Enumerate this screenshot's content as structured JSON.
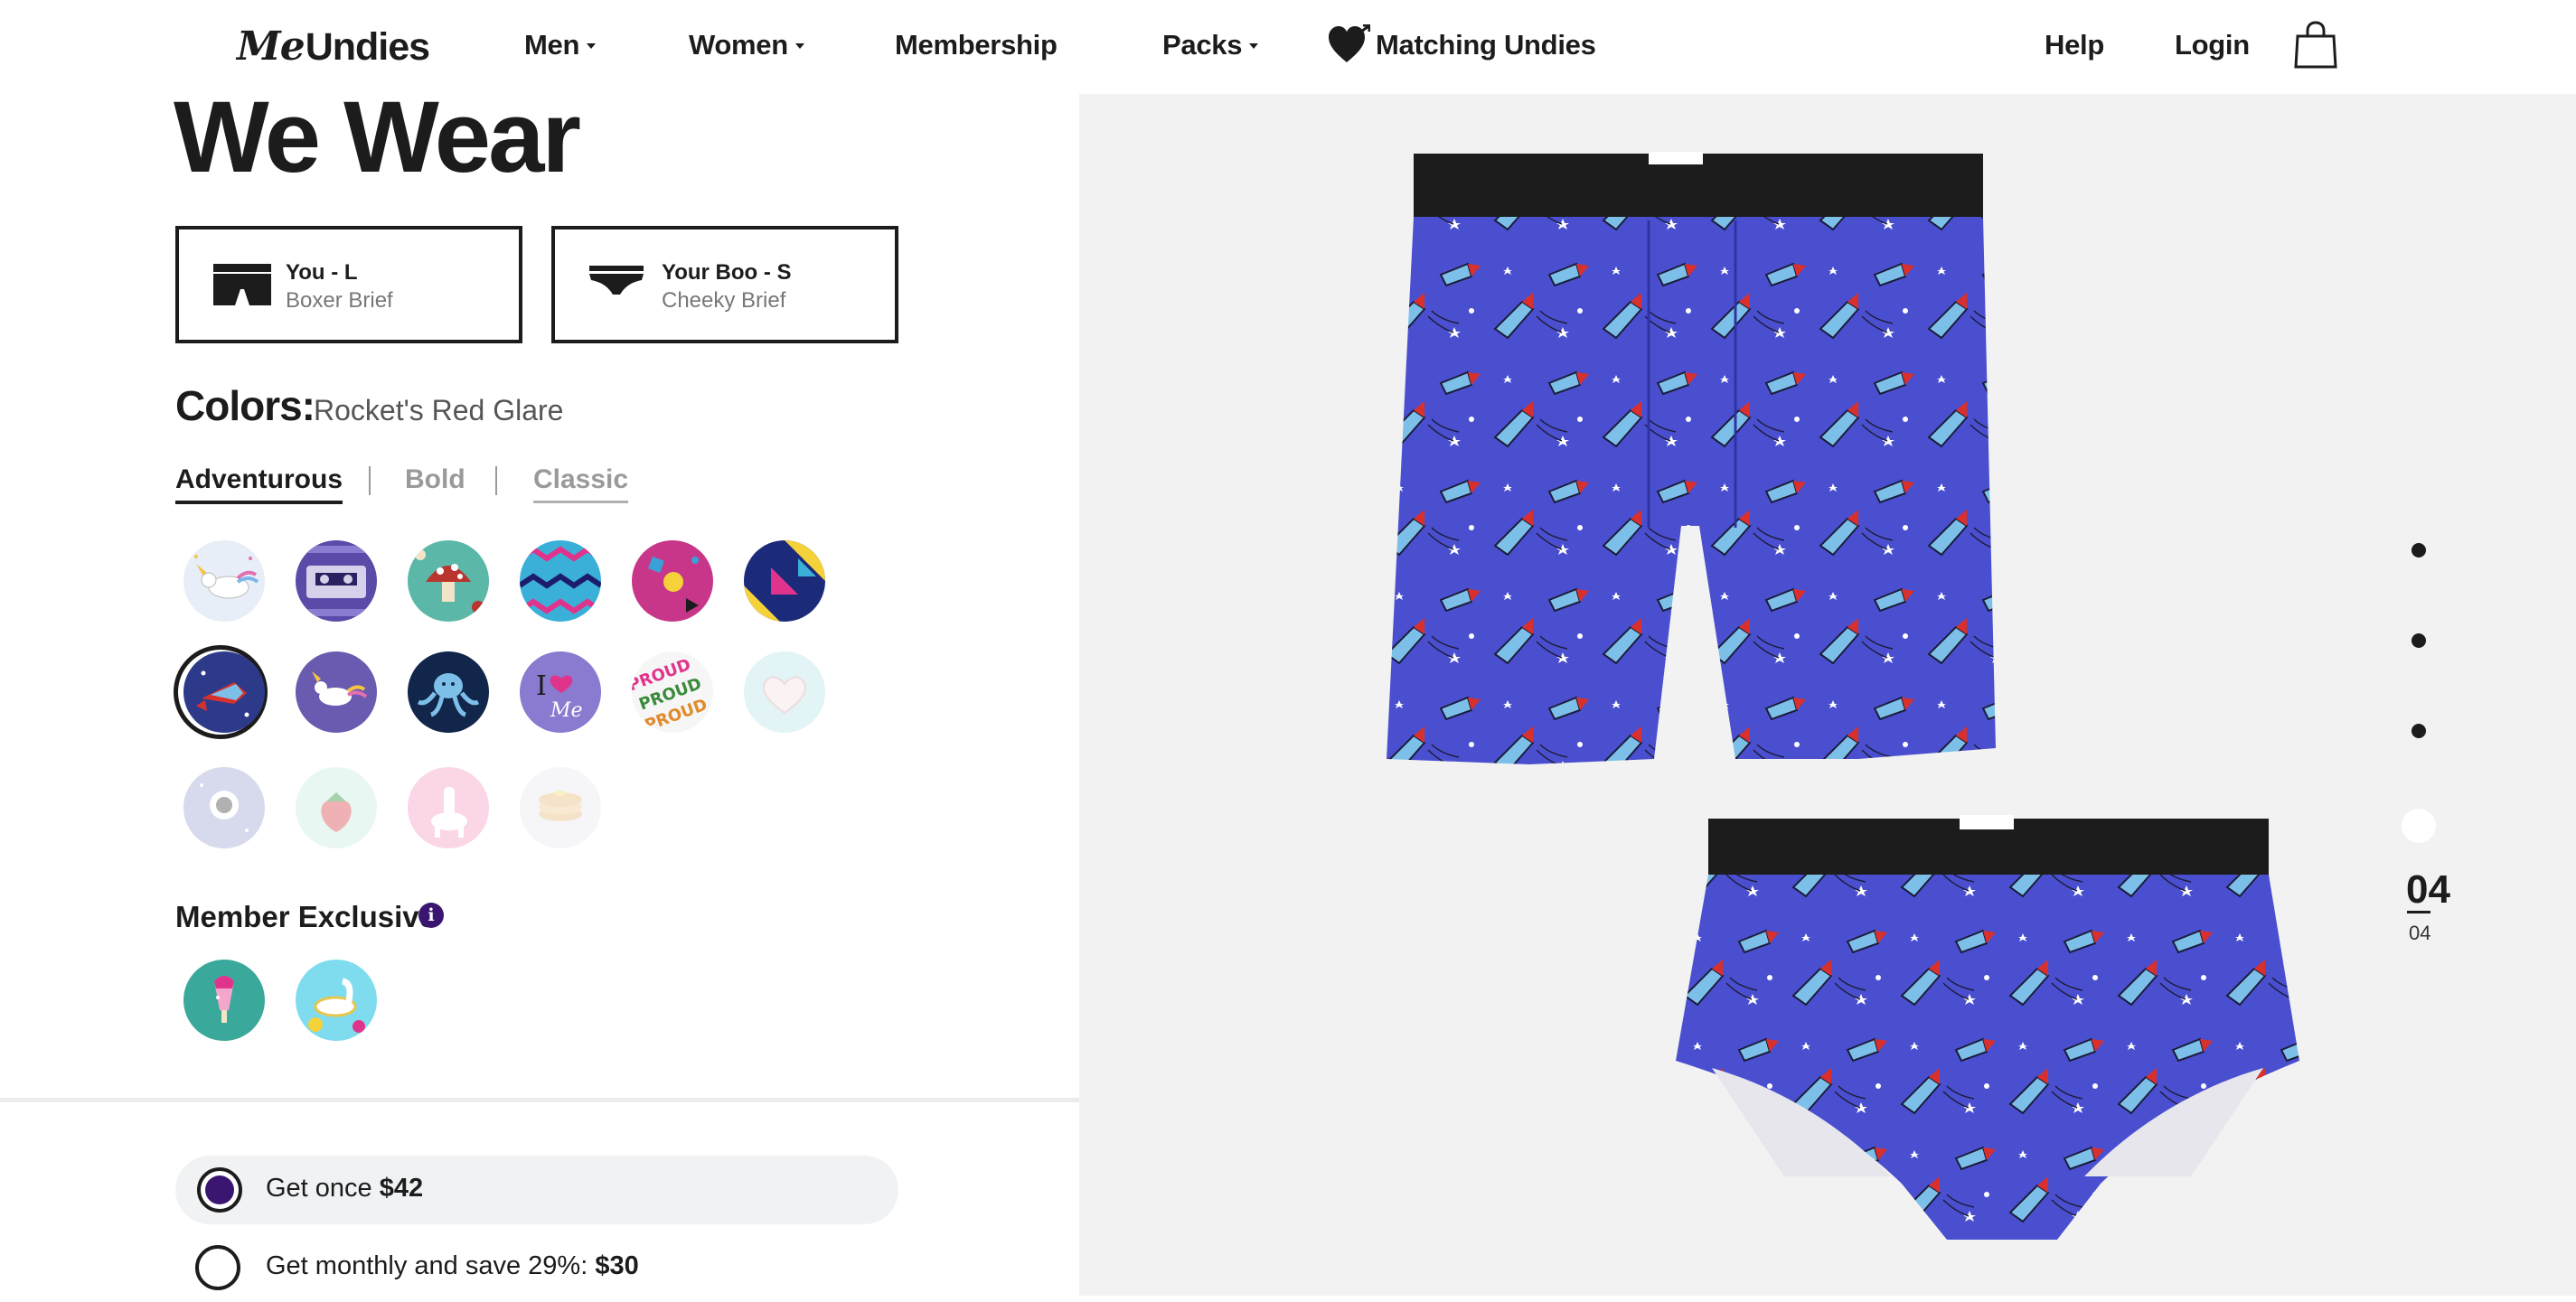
{
  "header": {
    "logo_me": "Me",
    "logo_rest": "Undies",
    "nav": [
      {
        "label": "Men",
        "dropdown": true
      },
      {
        "label": "Women",
        "dropdown": true
      },
      {
        "label": "Membership",
        "dropdown": false
      },
      {
        "label": "Packs",
        "dropdown": true
      },
      {
        "label": "Matching Undies",
        "dropdown": false
      }
    ],
    "help": "Help",
    "login": "Login"
  },
  "main": {
    "heading": "We Wear",
    "fits": [
      {
        "name": "You - L",
        "style": "Boxer Brief"
      },
      {
        "name": "Your Boo - S",
        "style": "Cheeky Brief"
      }
    ],
    "colors_label": "Colors:",
    "selected_color": "Rocket's Red Glare",
    "categories": [
      "Adventurous",
      "Bold",
      "Classic"
    ],
    "active_category": "Adventurous",
    "member_exclusive_label": "Member Exclusive",
    "info_icon": "i",
    "purchase_options": [
      {
        "text": "Get once ",
        "price": "$42",
        "selected": true
      },
      {
        "text": "Get monthly and save 29%: ",
        "price": "$30",
        "selected": false
      }
    ]
  },
  "gallery": {
    "current": "04",
    "total": "04"
  },
  "colors": {
    "accent": "#3a1670",
    "fabric_blue": "#4a4fd0",
    "panel_bg": "#f2f2f2"
  }
}
